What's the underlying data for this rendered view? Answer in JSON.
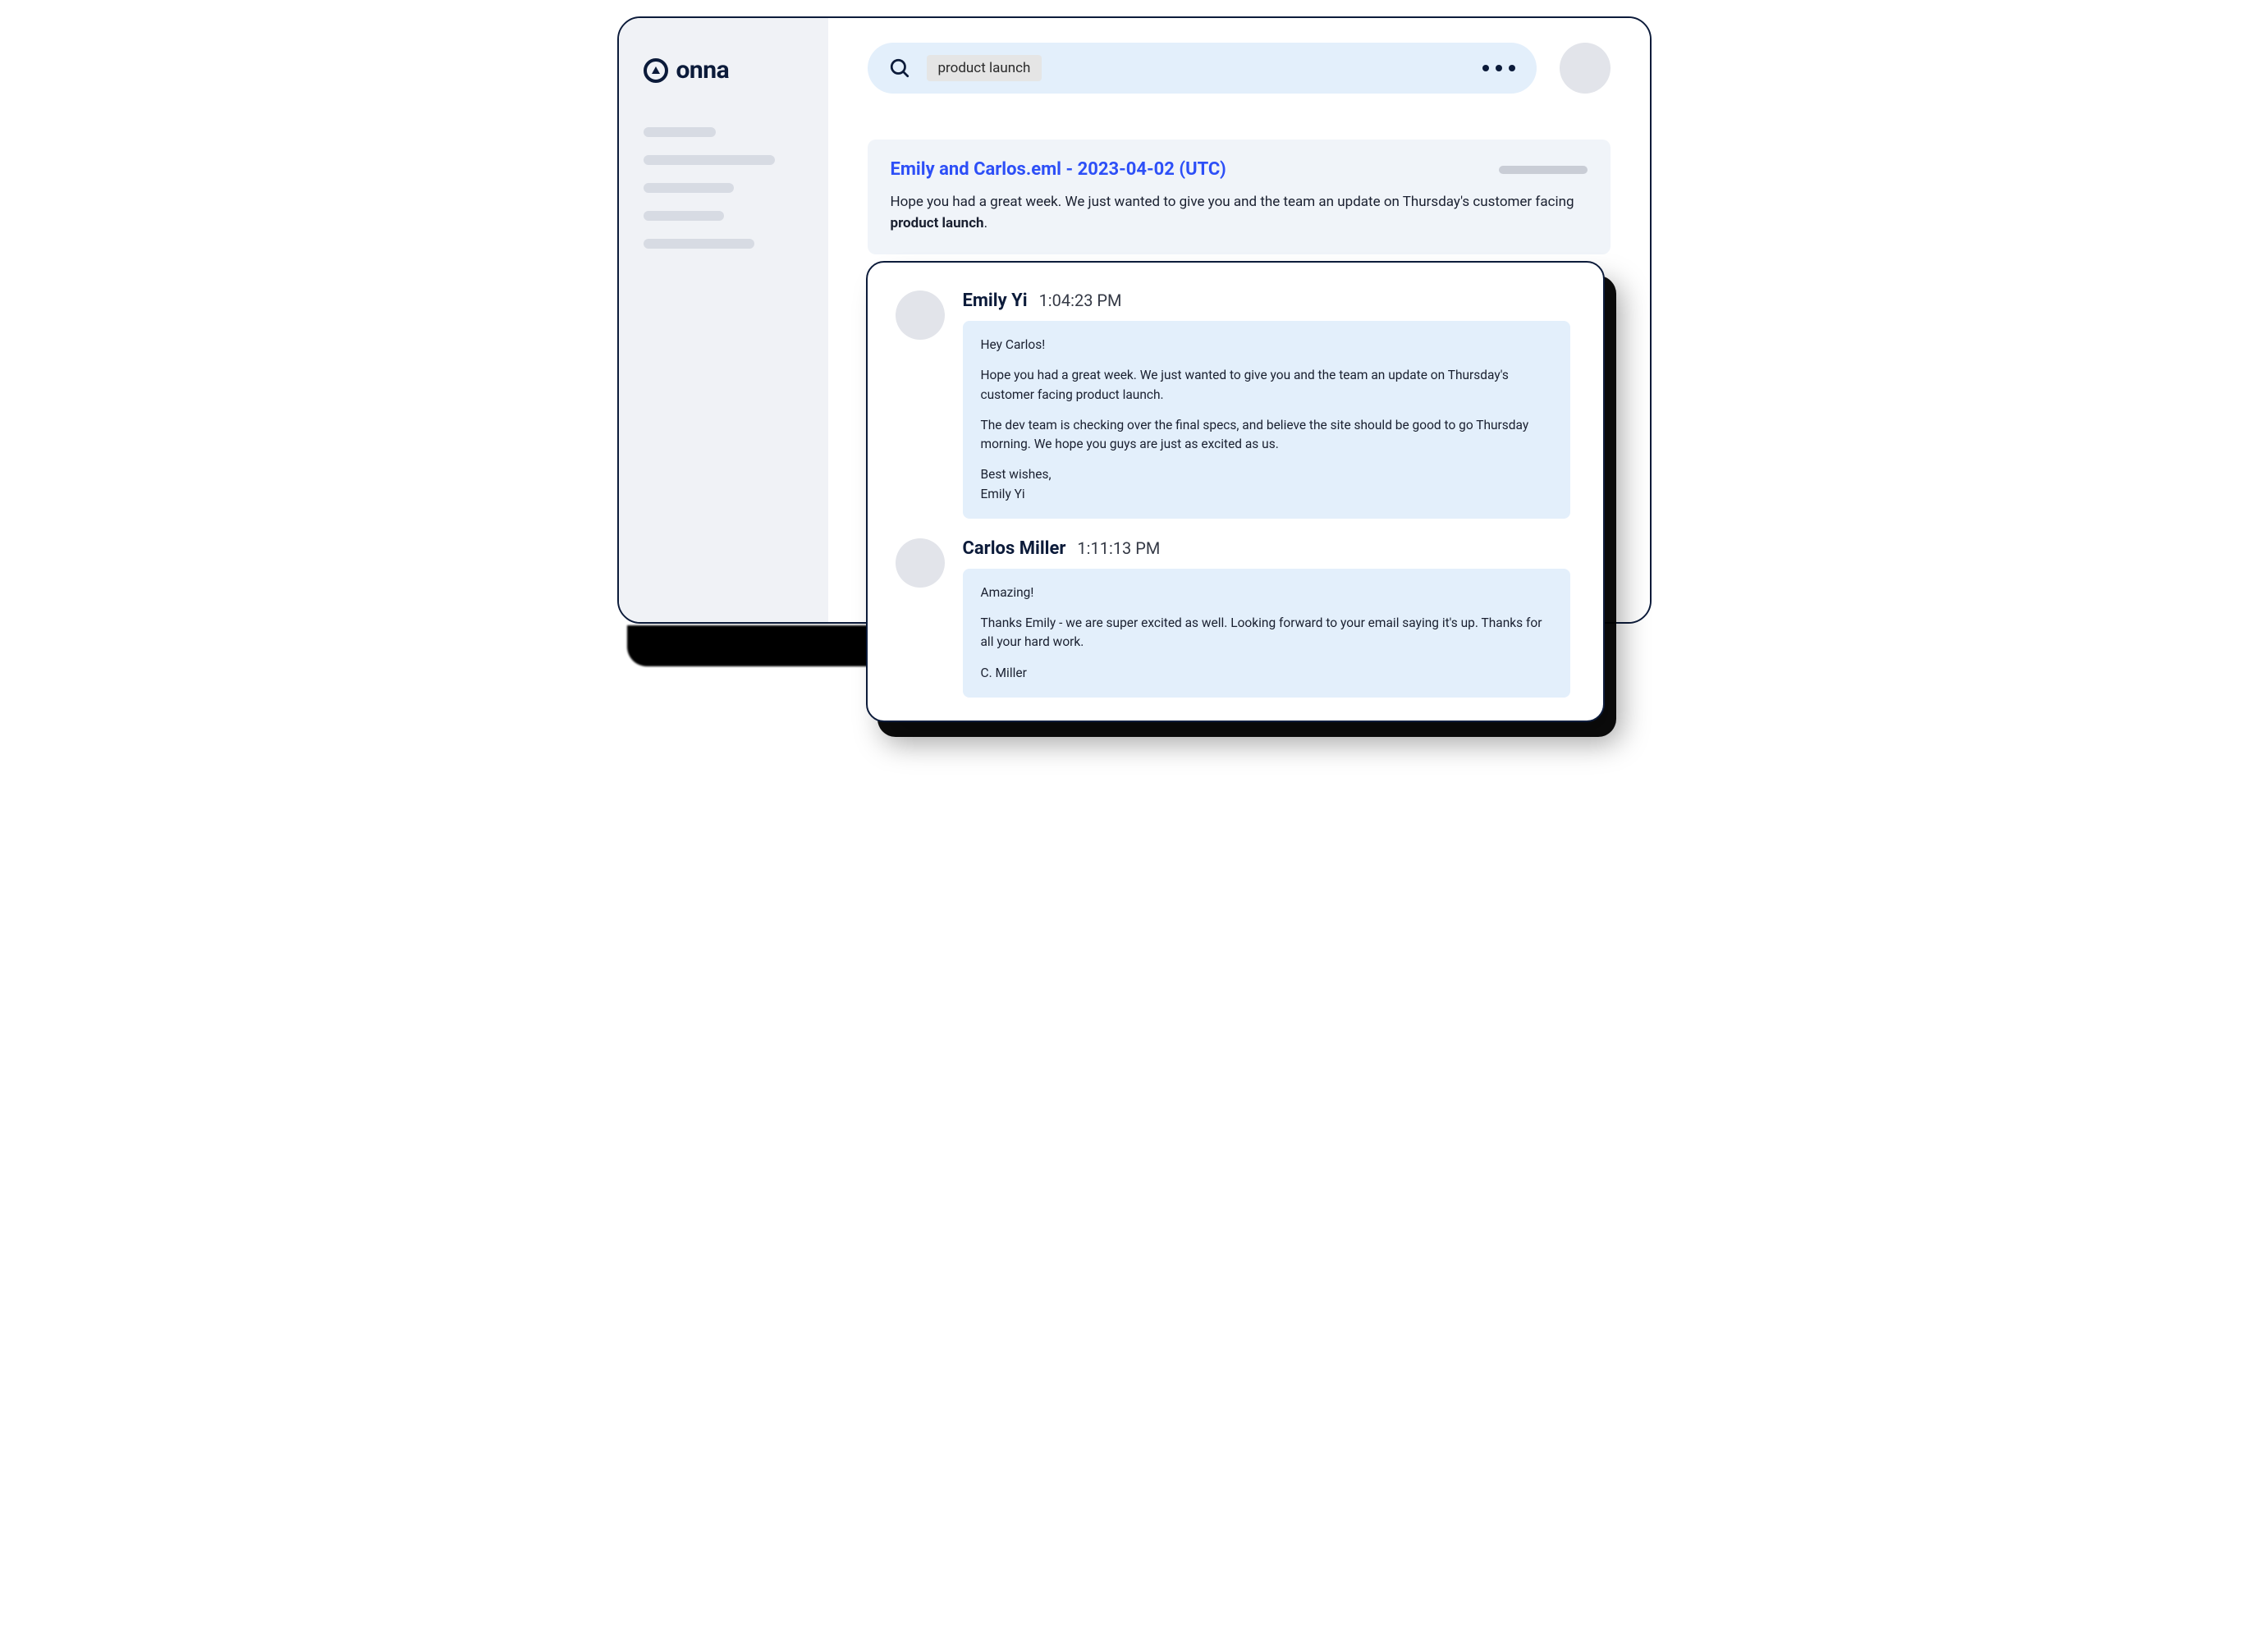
{
  "brand": {
    "name": "onna"
  },
  "search": {
    "chip": "product launch"
  },
  "result": {
    "title": "Emily and Carlos.eml - 2023-04-02 (UTC)",
    "snippet_prefix": "Hope you had a great week. We just wanted to give you and the team an update on Thursday's customer facing ",
    "snippet_bold": "product launch",
    "snippet_suffix": "."
  },
  "thread": [
    {
      "name": "Emily Yi",
      "time": "1:04:23 PM",
      "paragraphs": [
        "Hey Carlos!",
        "Hope you had a great week. We just wanted to give you and the team an update on Thursday's customer facing product launch.",
        "The dev team is checking over the final specs, and believe the site should be good to go Thursday morning. We hope you guys are just as excited as us."
      ],
      "sign1": "Best wishes,",
      "sign2": "Emily Yi"
    },
    {
      "name": "Carlos Miller",
      "time": "1:11:13 PM",
      "paragraphs": [
        "Amazing!",
        "Thanks Emily - we are super excited as well. Looking forward to your email saying it's up. Thanks for all your hard work."
      ],
      "sign1": "C. Miller",
      "sign2": ""
    }
  ]
}
